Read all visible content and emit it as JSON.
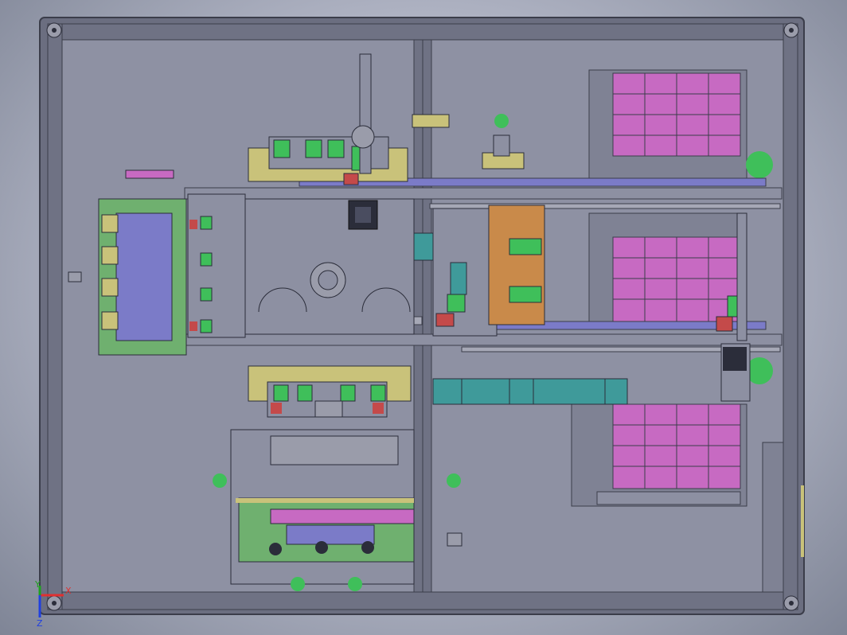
{
  "viewport": {
    "background": "#b9bccb",
    "triad": {
      "x_label": "X",
      "y_label": "Y",
      "z_label": "Z",
      "x_color": "#e03030",
      "y_color": "#20a020",
      "z_color": "#2040e0"
    }
  },
  "colors": {
    "frame": "#6b6e80",
    "frame_edge": "#3b3d4a",
    "plate": "#8d90a2",
    "pink": "#c76ac2",
    "teal": "#3f9a9a",
    "green": "#3fbf5a",
    "yellow": "#c9c27a",
    "red": "#c44a4a",
    "blue": "#7b7bc8",
    "orange": "#c98a4a",
    "dark": "#2b2d3a"
  },
  "components": {
    "tray_stacks": [
      "tray-stack-top",
      "tray-stack-middle",
      "tray-stack-bottom"
    ],
    "conveyors": [
      "conveyor-upper",
      "conveyor-lower"
    ],
    "modules": [
      "left-clamp-module",
      "center-turntable",
      "top-gripper-module",
      "bottom-gripper-module",
      "bottom-feeder-module",
      "right-gantry-module"
    ]
  }
}
